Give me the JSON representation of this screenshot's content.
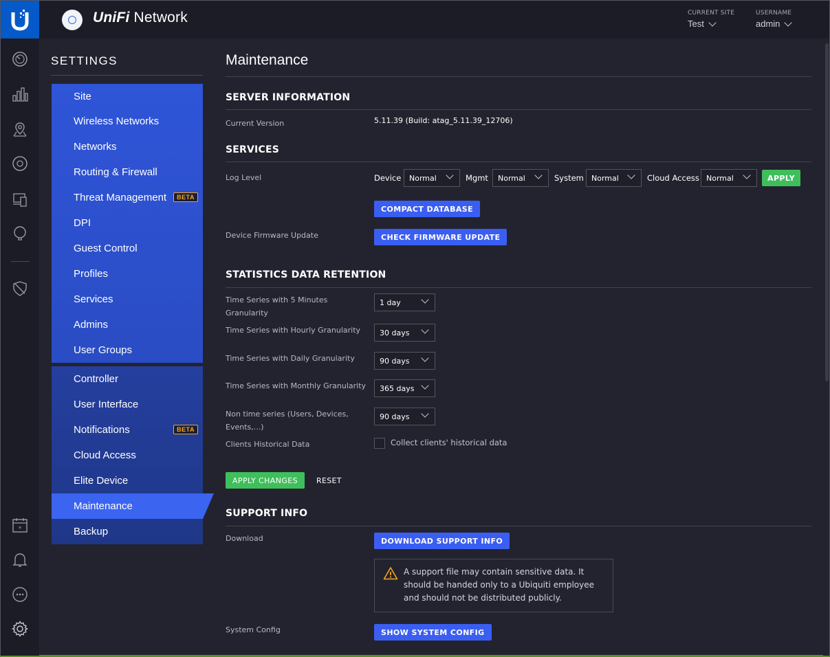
{
  "app": {
    "brand_styled": "UniFi",
    "brand_rest": " Network"
  },
  "header": {
    "current_site_label": "CURRENT SITE",
    "current_site_value": "Test",
    "username_label": "USERNAME",
    "username_value": "admin"
  },
  "rail_icons": [
    "dashboard-icon",
    "statistics-icon",
    "map-icon",
    "devices-icon",
    "clients-icon",
    "insights-icon",
    "threat-shield-icon",
    "events-calendar-icon",
    "alerts-bell-icon",
    "chat-icon",
    "settings-gear-icon"
  ],
  "settings": {
    "title": "SETTINGS",
    "group1": [
      {
        "label": "Site"
      },
      {
        "label": "Wireless Networks"
      },
      {
        "label": "Networks"
      },
      {
        "label": "Routing & Firewall"
      },
      {
        "label": "Threat Management",
        "badge": "BETA"
      },
      {
        "label": "DPI"
      },
      {
        "label": "Guest Control"
      },
      {
        "label": "Profiles"
      },
      {
        "label": "Services"
      },
      {
        "label": "Admins"
      },
      {
        "label": "User Groups"
      }
    ],
    "group2": [
      {
        "label": "Controller"
      },
      {
        "label": "User Interface"
      },
      {
        "label": "Notifications",
        "badge": "BETA"
      },
      {
        "label": "Cloud Access"
      },
      {
        "label": "Elite Device"
      },
      {
        "label": "Maintenance",
        "active": true
      },
      {
        "label": "Backup"
      }
    ]
  },
  "main": {
    "title": "Maintenance",
    "server_info": {
      "heading": "SERVER INFORMATION",
      "version_label": "Current Version",
      "version_value": "5.11.39 (Build: atag_5.11.39_12706)"
    },
    "services": {
      "heading": "SERVICES",
      "log_level_label": "Log Level",
      "device_label": "Device",
      "device_value": "Normal",
      "mgmt_label": "Mgmt",
      "mgmt_value": "Normal",
      "system_label": "System",
      "system_value": "Normal",
      "cloud_label": "Cloud Access",
      "cloud_value": "Normal",
      "apply_label": "APPLY",
      "compact_label": "COMPACT DATABASE",
      "firmware_label": "Device Firmware Update",
      "firmware_button": "CHECK FIRMWARE UPDATE"
    },
    "retention": {
      "heading": "STATISTICS DATA RETENTION",
      "rows": [
        {
          "label": "Time Series with 5 Minutes Granularity",
          "value": "1 day"
        },
        {
          "label": "Time Series with Hourly Granularity",
          "value": "30 days"
        },
        {
          "label": "Time Series with Daily Granularity",
          "value": "90 days"
        },
        {
          "label": "Time Series with Monthly Granularity",
          "value": "365 days"
        },
        {
          "label": "Non time series (Users, Devices, Events,...)",
          "value": "90 days"
        }
      ],
      "clients_label": "Clients Historical Data",
      "clients_checkbox_label": "Collect clients' historical data",
      "apply_changes": "APPLY CHANGES",
      "reset": "RESET"
    },
    "support": {
      "heading": "SUPPORT INFO",
      "download_label": "Download",
      "download_button": "DOWNLOAD SUPPORT INFO",
      "warning": "A support file may contain sensitive data. It should be handed only to a Ubiquiti employee and should not be distributed publicly.",
      "sysconfig_label": "System Config",
      "sysconfig_button": "SHOW SYSTEM CONFIG"
    }
  }
}
